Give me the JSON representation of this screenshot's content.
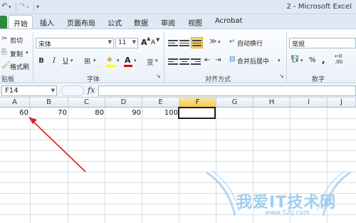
{
  "title_bar": {
    "window_title": "2  -  Microsoft Excel",
    "quick_access": [
      "save-icon",
      "undo-icon",
      "redo-icon",
      "customize-icon"
    ]
  },
  "ribbon_tabs": [
    "开始",
    "插入",
    "页面布局",
    "公式",
    "数据",
    "审阅",
    "视图",
    "Acrobat"
  ],
  "active_tab": "开始",
  "clipboard": {
    "cut": "剪切",
    "copy": "复制",
    "format_painter": "格式刷",
    "group_label": "贴板"
  },
  "font": {
    "font_name": "宋体",
    "font_size": "11",
    "bold": "B",
    "italic": "I",
    "underline": "U",
    "font_color_sample": "A",
    "grow_font": "A",
    "shrink_font": "A",
    "phonetic": "变",
    "group_label": "字体"
  },
  "alignment": {
    "wrap_text": "自动换行",
    "merge_center": "合并后居中",
    "group_label": "对齐方式"
  },
  "number": {
    "format": "常规",
    "percent": "%",
    "comma": ",",
    "decimals": ".00",
    "group_label": "数字"
  },
  "formula_bar": {
    "name_box": "F14",
    "fx_label": "fx",
    "formula": ""
  },
  "columns": [
    "A",
    "B",
    "C",
    "D",
    "E",
    "F",
    "G",
    "H",
    "I",
    "J"
  ],
  "selected_column": "F",
  "rows": [
    [
      "60",
      "70",
      "80",
      "90",
      "100",
      "",
      "",
      "",
      "",
      ""
    ]
  ],
  "watermark": {
    "main": "我爱IT技术网",
    "sub": "www.52ij.com"
  },
  "colors": {
    "annotation_arrow": "#e02020",
    "selected_header": "#f5c74d",
    "file_tab": "#2e8b3a"
  }
}
